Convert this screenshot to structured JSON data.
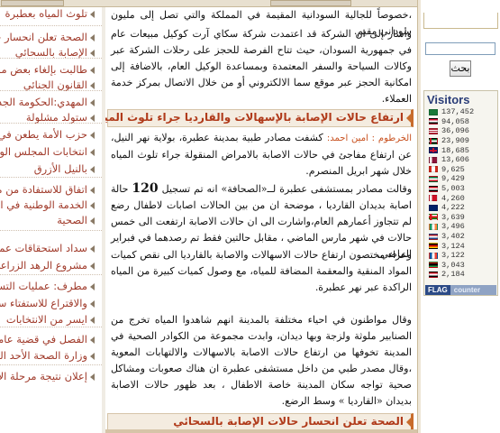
{
  "sidebar": {
    "search_value": "",
    "search_button": "بحث",
    "visitors": {
      "title": "Visitors",
      "rows": [
        {
          "count": "137,452",
          "flag": "sa"
        },
        {
          "count": "94,058",
          "flag": "sd"
        },
        {
          "count": "36,096",
          "flag": "us"
        },
        {
          "count": "23,909",
          "flag": "ae"
        },
        {
          "count": "18,685",
          "flag": "gb"
        },
        {
          "count": "13,606",
          "flag": "qa"
        },
        {
          "count": "9,625",
          "flag": "ca"
        },
        {
          "count": "9,429",
          "flag": "kw"
        },
        {
          "count": "5,003",
          "flag": "eg"
        },
        {
          "count": "4,260",
          "flag": "bh"
        },
        {
          "count": "4,222",
          "flag": "au"
        },
        {
          "count": "3,639",
          "flag": "om"
        },
        {
          "count": "3,496",
          "flag": "ie"
        },
        {
          "count": "3,402",
          "flag": "nl"
        },
        {
          "count": "3,124",
          "flag": "de"
        },
        {
          "count": "3,122",
          "flag": "fr"
        },
        {
          "count": "3,043",
          "flag": "ly"
        },
        {
          "count": "2,184",
          "flag": "ye"
        }
      ],
      "badge_flag": "FLAG",
      "badge_counter": "counter"
    }
  },
  "news": [
    "تلوث المياه بعطبرة",
    "الصحة تعلن انحسار حالات",
    "الإصابة بالسحائي",
    "طالبت بإلغاء بعض مواد",
    "القانون الجنائي",
    "المهدي:الحكومة الجديدة",
    "ستولد مشلولة",
    "حزب الأمة يطعن في نتائج",
    "انتخابات المجلس الولائي",
    "بالنيل الأزرق",
    "اتفاق للاستفادة من منسوبي",
    "الخدمة الوطنية في المجتمع",
    "الصحية",
    "سداد استحقاقات عمال",
    "مشروع الرهد الزراعي",
    "مطرف: عمليات التسجيل",
    "والاقتراع للاستفتاء ستكون",
    "ايسر من الانتخابات",
    "الفصل في قضية عامل",
    "وزارة الصحة الأحد المقبل",
    "إعلان نتيجة مرحلة الأساس"
  ],
  "article": {
    "para1": "،خصوصاً للجالية السودانية المقيمة في المملكة والتي تصل إلى مليون سوداني مقيم.",
    "para2": "وأشار إلى ان الشركة قد اعتمدت شركة سكاي آرت كوكيل مبيعات عام في جمهورية السودان، حيث تتاح الفرصة للحجز على رحلات الشركة عبر وكالات السياحة والسفر المعتمدة وبمساعدة الوكيل العام، بالاضافة إلى امكانية الحجز عبر موقع سما الالكتروني أو من خلال الاتصال بمركز خدمة العملاء.",
    "section1_title": "ارتفاع حالات الإصابة بالإسهالات والقارديا جراء تلوث المياه بعطبرة",
    "byline": "الخرطوم : امين احمد:",
    "para3": "كشفت مصادر طبية بمدينة عطبرة، بولاية نهر النيل، عن ارتفاع مفاجئ في حالات الاصابة بالامراض المنقولة جراء تلوث المياه خلال شهر ابريل المنصرم.",
    "para4a": "وقالت مصادر بمستشفى عطبرة لــ«الصحافة» انه تم تسجيل",
    "big_number": "120",
    "para4b": "حالة اصابة بديدان القارديا ، موضحة ان من بين الحالات اصابات لاطفال رضع لم تتجاوز أعمارهم العام،واشارت الى ان حالات الاصابة ارتفعت الى خمس حالات في شهر مارس الماضي ، مقابل حالتين فقط تم رصدهما في فبراير الماضي.",
    "para5": "وعزاء مختصون ارتفاع حالات الاسهالات والاصابة بالقارديا الى نقص كميات المواد المنقية والمعقمة المضافة للمياه، مع وصول كميات كبيرة من المياه الراكدة عبر نهر عطبرة.",
    "para6": "وقال مواطنون في احياء مختلفة بالمدينة انهم شاهدوا المياه تخرج من الصنابير ملوثة ولزجة وبها ديدان، وابدت مجموعة من الكوادر الصحية في المدينة تخوفها من ارتفاع حالات الاصابة بالاسهالات والالتهابات المعوية ،وقال مصدر طبي من داخل مستشفى عطبرة ان هناك صعوبات ومشاكل صحية تواجه سكان المدينة خاصة الاطفال ، بعد ظهور حالات الاصابة بديدان «القارديا » وسط الرضع.",
    "section2_title": "الصحة تعلن انحسار حالات الإصابة بالسحائي"
  }
}
